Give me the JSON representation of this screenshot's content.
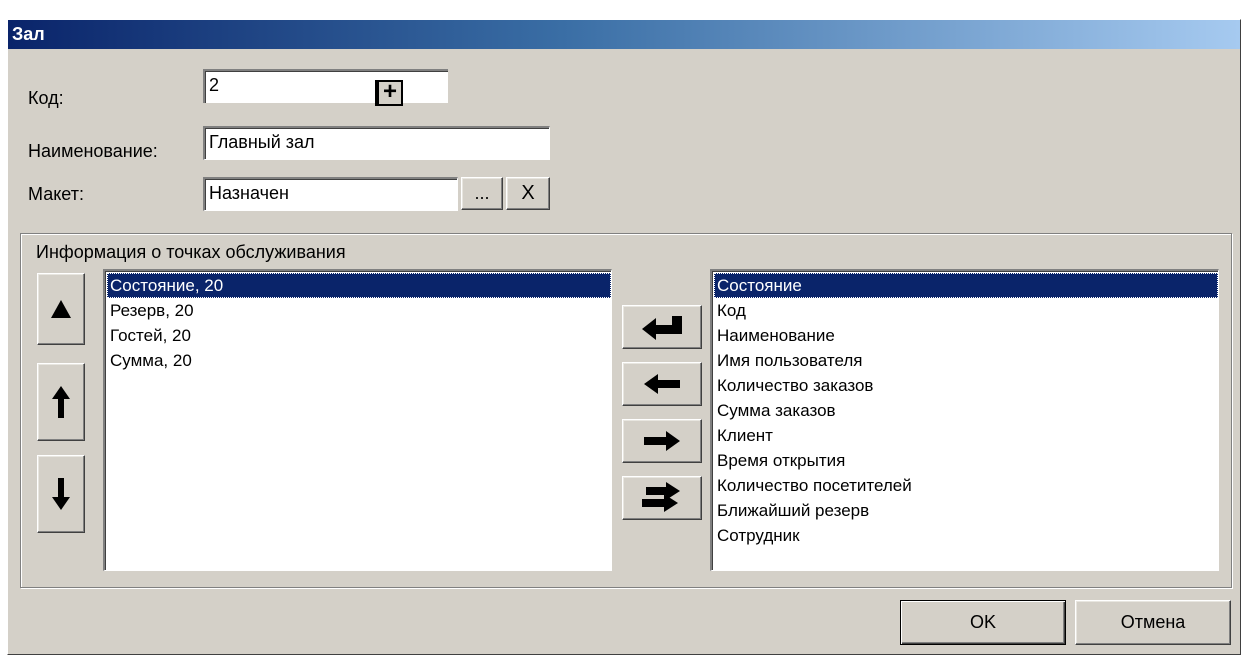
{
  "window": {
    "title": "Зал"
  },
  "form": {
    "code_label": "Код:",
    "code_value": "2",
    "code_decrement": "−",
    "code_increment": "+",
    "name_label": "Наименование:",
    "name_value": "Главный зал",
    "layout_label": "Макет:",
    "layout_value": "Назначен",
    "browse_label": "...",
    "clear_label": "X"
  },
  "group": {
    "title": "Информация о точках обслуживания",
    "selected_items": [
      "Состояние, 20",
      "Резерв, 20",
      "Гостей, 20",
      "Сумма, 20"
    ],
    "available_items": [
      "Состояние",
      "Код",
      "Наименование",
      "Имя пользователя",
      "Количество заказов",
      "Сумма заказов",
      "Клиент",
      "Время открытия",
      "Количество посетителей",
      "Ближайший резерв",
      "Сотрудник"
    ]
  },
  "buttons": {
    "ok": "OK",
    "cancel": "Отмена"
  },
  "icons": {
    "move_top": "triangle-up-icon",
    "move_up": "arrow-up-icon",
    "move_down": "arrow-down-icon",
    "add_enter": "enter-arrow-icon",
    "move_left": "arrow-left-icon",
    "move_right": "arrow-right-icon",
    "transfer_all": "double-arrow-icon"
  },
  "colors": {
    "selection": "#0a246a",
    "title_start": "#0a246a",
    "title_end": "#a6caf0",
    "face": "#d4d0c8"
  }
}
